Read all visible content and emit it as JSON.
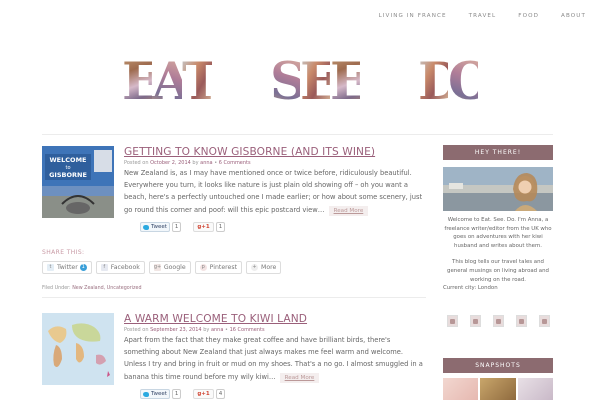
{
  "nav": {
    "items": [
      "LIVING IN FRANCE",
      "TRAVEL",
      "FOOD",
      "ABOUT"
    ]
  },
  "logo": {
    "text": "EAT SEE DO",
    "words": [
      "EAT",
      "SEE",
      "DO"
    ]
  },
  "posts": [
    {
      "title": "GETTING TO KNOW GISBORNE (AND ITS WINE)",
      "meta_prefix": "Posted on",
      "date": "October 2, 2014",
      "meta_by": "by",
      "author": "anna",
      "comments": "6 Comments",
      "thumb_caption": [
        "WELCOME",
        "to",
        "GISBORNE"
      ],
      "excerpt": "New Zealand is, as I may have mentioned once or twice before, ridiculously beautiful. Everywhere you turn, it looks like nature is just plain old showing off – oh you want a beach, here's a perfectly untouched one I made earlier; or how about some scenery, just go round this corner and poof: will this epic postcard view…",
      "read_more": "Read More",
      "tweet_label": "Tweet",
      "tweet_count": "1",
      "gplus_label": "g+1",
      "gplus_count": "1",
      "share_label": "SHARE THIS:",
      "share_buttons": [
        "Twitter",
        "Facebook",
        "Google",
        "Pinterest",
        "More"
      ],
      "twitter_badge": "1",
      "filed_prefix": "Filed Under:",
      "filed_categories": "New Zealand, Uncategorized"
    },
    {
      "title": "A WARM WELCOME TO KIWI LAND",
      "meta_prefix": "Posted on",
      "date": "September 23, 2014",
      "meta_by": "by",
      "author": "anna",
      "comments": "16 Comments",
      "excerpt": "Apart from the fact that they make great coffee and have brilliant birds, there's something about New Zealand that just always makes me feel warm and welcome. Unless I try and bring in fruit or mud on my shoes. That's a no go. I almost smuggled in a banana this time round before my wily kiwi…",
      "read_more": "Read More",
      "tweet_label": "Tweet",
      "tweet_count": "1",
      "gplus_label": "g+1",
      "gplus_count": "4"
    }
  ],
  "sidebar": {
    "hey_heading": "HEY  THERE!",
    "about_p1": "Welcome to Eat. See. Do. I'm Anna, a freelance writer/editor from the UK who goes on adventures with her kiwi husband and writes about them.",
    "about_p2": "This blog tells our travel tales and general musings on living abroad and working on the road.",
    "current_city": "Current city: London",
    "snapshots_heading": "SNAPSHOTS"
  },
  "colors": {
    "accent": "#9a5f7a",
    "sidebar_header": "#8c6b70"
  }
}
